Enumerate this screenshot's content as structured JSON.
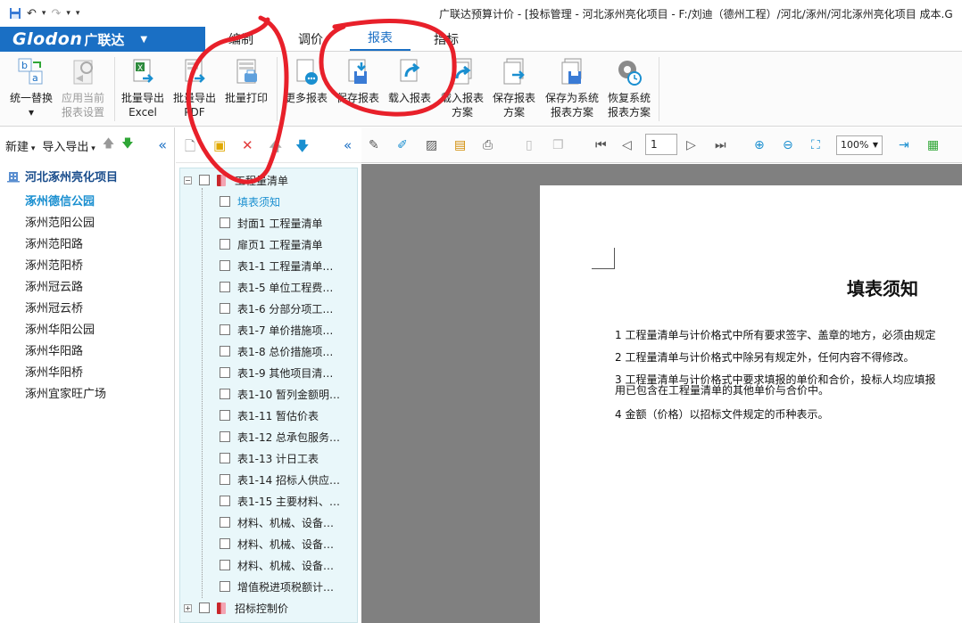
{
  "window": {
    "title": "广联达预算计价 - [投标管理 - 河北涿州亮化项目 - F:/刘迪（德州工程）/河北/涿州/河北涿州亮化项目  成本.G"
  },
  "quick_access": {
    "more": "▾"
  },
  "brand": {
    "logo": "Glodon",
    "name": "广联达"
  },
  "tabs": [
    {
      "label": "编制"
    },
    {
      "label": "调价"
    },
    {
      "label": "报表"
    },
    {
      "label": "指标"
    }
  ],
  "ribbon": [
    {
      "label": "统一替换\n▾",
      "icon": "replace-icon"
    },
    {
      "label": "应用当前\n报表设置",
      "icon": "apply-settings-icon"
    },
    {
      "label": "批量导出\nExcel",
      "icon": "export-excel-icon"
    },
    {
      "label": "批量导出\nPDF",
      "icon": "export-pdf-icon"
    },
    {
      "label": "批量打印",
      "icon": "print-icon"
    },
    {
      "label": "更多报表",
      "icon": "more-reports-icon"
    },
    {
      "label": "保存报表",
      "icon": "save-report-icon"
    },
    {
      "label": "载入报表",
      "icon": "load-report-icon"
    },
    {
      "label": "载入报表\n方案",
      "icon": "load-scheme-icon"
    },
    {
      "label": "保存报表\n方案",
      "icon": "save-scheme-icon"
    },
    {
      "label": "保存为系统\n报表方案",
      "icon": "save-system-scheme-icon"
    },
    {
      "label": "恢复系统\n报表方案",
      "icon": "restore-system-icon"
    }
  ],
  "left_panel": {
    "new_label": "新建",
    "import_export_label": "导入导出",
    "root": "河北涿州亮化项目",
    "items": [
      "涿州德信公园",
      "涿州范阳公园",
      "涿州范阳路",
      "涿州范阳桥",
      "涿州冠云路",
      "涿州冠云桥",
      "涿州华阳公园",
      "涿州华阳路",
      "涿州华阳桥",
      "涿州宜家旺广场"
    ]
  },
  "report_tree": {
    "group": "工程量清单",
    "items": [
      "填表须知",
      "封面1 工程量清单",
      "扉页1 工程量清单",
      "表1-1 工程量清单…",
      "表1-5 单位工程费…",
      "表1-6 分部分项工…",
      "表1-7 单价措施项…",
      "表1-8 总价措施项…",
      "表1-9 其他项目清…",
      "表1-10 暂列金额明…",
      "表1-11 暂估价表",
      "表1-12 总承包服务…",
      "表1-13 计日工表",
      "表1-14 招标人供应…",
      "表1-15 主要材料、…",
      "材料、机械、设备…",
      "材料、机械、设备…",
      "材料、机械、设备…",
      "增值税进项税额计…"
    ],
    "group2": "招标控制价"
  },
  "preview": {
    "page_number": "1",
    "zoom": "100%"
  },
  "document": {
    "title": "填表须知",
    "lines": [
      "1   工程量清单与计价格式中所有要求签字、盖章的地方，必须由规定",
      "2   工程量清单与计价格式中除另有规定外，任何内容不得修改。",
      "3   工程量清单与计价格式中要求填报的单价和合价，投标人均应填报",
      "用已包含在工程量清单的其他单价与合价中。",
      "4   金额（价格）以招标文件规定的币种表示。"
    ]
  },
  "colors": {
    "brand_blue": "#1a6fc4",
    "annotation_red": "#e8202a",
    "tree_bg": "#e9f7fa",
    "canvas_gray": "#808080"
  }
}
